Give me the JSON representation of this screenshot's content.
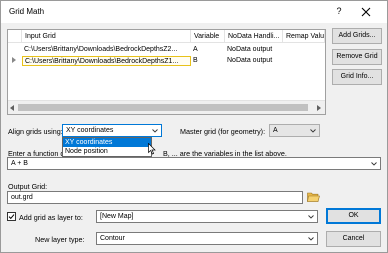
{
  "window": {
    "title": "Grid Math",
    "help_glyph": "?",
    "close_glyph": "✕"
  },
  "grid_table": {
    "columns": [
      "Input Grid",
      "Variable",
      "NoData Handli...",
      "Remap Valu"
    ],
    "rows": [
      {
        "input_grid": "C:\\Users\\Brittany\\Downloads\\BedrockDepthsZ2...",
        "variable": "A",
        "nodata": "NoData output",
        "remap": ""
      },
      {
        "input_grid": "C:\\Users\\Brittany\\Downloads\\BedrockDepthsZ1...",
        "variable": "B",
        "nodata": "NoData output",
        "remap": ""
      }
    ]
  },
  "side_buttons": {
    "add_grids": "Add Grids...",
    "remove_grid": "Remove Grid",
    "grid_info": "Grid Info..."
  },
  "align": {
    "label": "Align grids using:",
    "value": "XY coordinates",
    "options": [
      "XY coordinates",
      "Node position"
    ]
  },
  "master": {
    "label": "Master grid (for geometry):",
    "value": "A"
  },
  "function": {
    "label_prefix": "Enter a function d",
    "label_suffix": "B, ... are the variables in the list above.",
    "value": "A + B"
  },
  "output": {
    "label": "Output Grid:",
    "value": "out.grd"
  },
  "add_layer": {
    "label": "Add grid as layer to:",
    "checked": true,
    "value": "[New Map]"
  },
  "layer_type": {
    "label": "New layer type:",
    "value": "Contour"
  },
  "actions": {
    "ok": "OK",
    "cancel": "Cancel"
  },
  "colors": {
    "accent": "#0078d7",
    "selected_row_border": "#e8c21a",
    "window_bg": "#f0f0f0"
  }
}
